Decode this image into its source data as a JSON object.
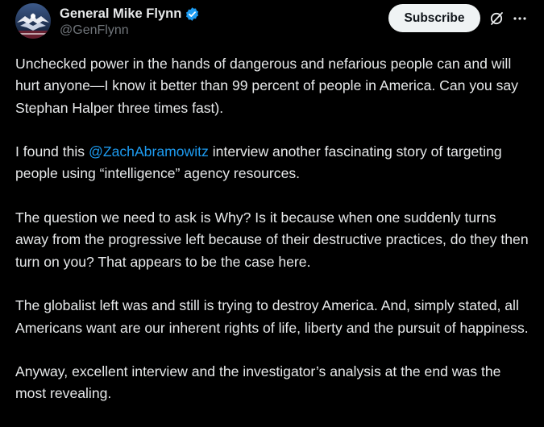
{
  "author": {
    "display_name": "General Mike Flynn",
    "handle": "@GenFlynn",
    "verified": true
  },
  "actions": {
    "subscribe_label": "Subscribe",
    "grok_icon": "grok-slash-circle-icon",
    "more_icon": "more-horizontal-icon"
  },
  "tweet": {
    "p1": "Unchecked power in the hands of dangerous and nefarious people can and will hurt anyone—I know it better than 99 percent of people in America. Can you say Stephan Halper three times fast).",
    "p2_before": "I found this ",
    "p2_mention": "@ZachAbramowitz",
    "p2_after": " interview another fascinating story of targeting people using “intelligence” agency resources.",
    "p3": "The question we need to ask is Why? Is it because when one suddenly turns away from the progressive left because of their destructive practices, do they then turn on you? That appears to be the case here.",
    "p4": "The globalist left was and still is trying to destroy America. And, simply stated, all Americans want are our inherent rights of life, liberty and the pursuit of happiness.",
    "p5": "Anyway, excellent interview and the investigator’s analysis at the end was the most revealing."
  },
  "colors": {
    "background": "#000000",
    "text": "#e7e9ea",
    "secondary_text": "#71767b",
    "link": "#1d9bf0",
    "verified_badge": "#1d9bf0",
    "button_bg": "#eff3f4"
  }
}
